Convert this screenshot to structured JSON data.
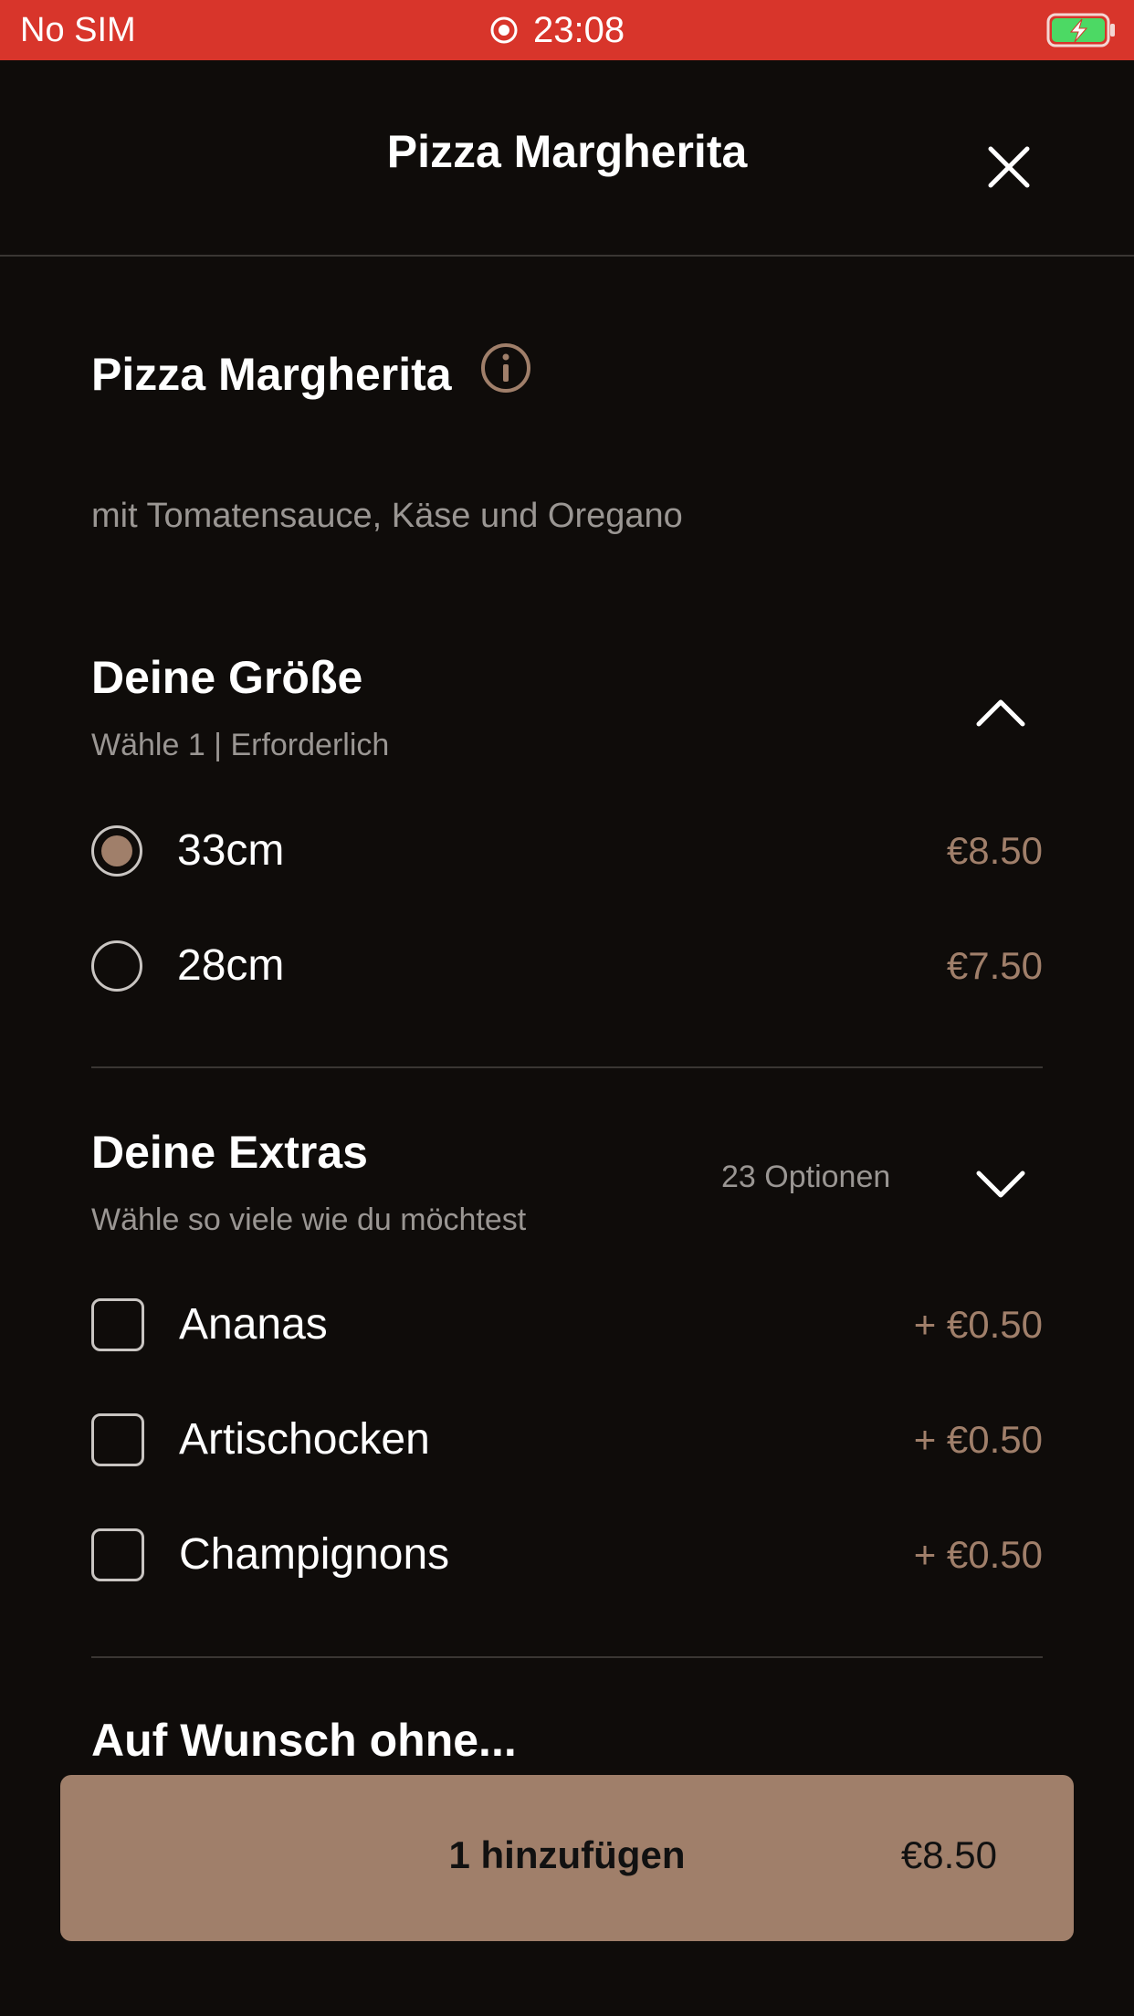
{
  "status_bar": {
    "carrier": "No SIM",
    "time": "23:08"
  },
  "header": {
    "title": "Pizza Margherita"
  },
  "item": {
    "name": "Pizza Margherita",
    "description": "mit Tomatensauce, Käse und Oregano"
  },
  "size_section": {
    "title": "Deine Größe",
    "subtitle": "Wähle 1  |  Erforderlich",
    "expanded": true,
    "options": [
      {
        "label": "33cm",
        "price": "€8.50",
        "selected": true
      },
      {
        "label": "28cm",
        "price": "€7.50",
        "selected": false
      }
    ]
  },
  "extras_section": {
    "title": "Deine Extras",
    "subtitle": "Wähle so viele wie du möchtest",
    "count_label": "23 Optionen",
    "options": [
      {
        "label": "Ananas",
        "price": "+ €0.50",
        "checked": false
      },
      {
        "label": "Artischocken",
        "price": "+ €0.50",
        "checked": false
      },
      {
        "label": "Champignons",
        "price": "+ €0.50",
        "checked": false
      }
    ]
  },
  "without_section": {
    "title": "Auf Wunsch ohne..."
  },
  "add_button": {
    "label": "1 hinzufügen",
    "price": "€8.50"
  },
  "colors": {
    "status_bar": "#d8352b",
    "background": "#0f0c0a",
    "accent": "#a07f6a",
    "muted_text": "#9a9693",
    "divider": "#3a3633"
  }
}
